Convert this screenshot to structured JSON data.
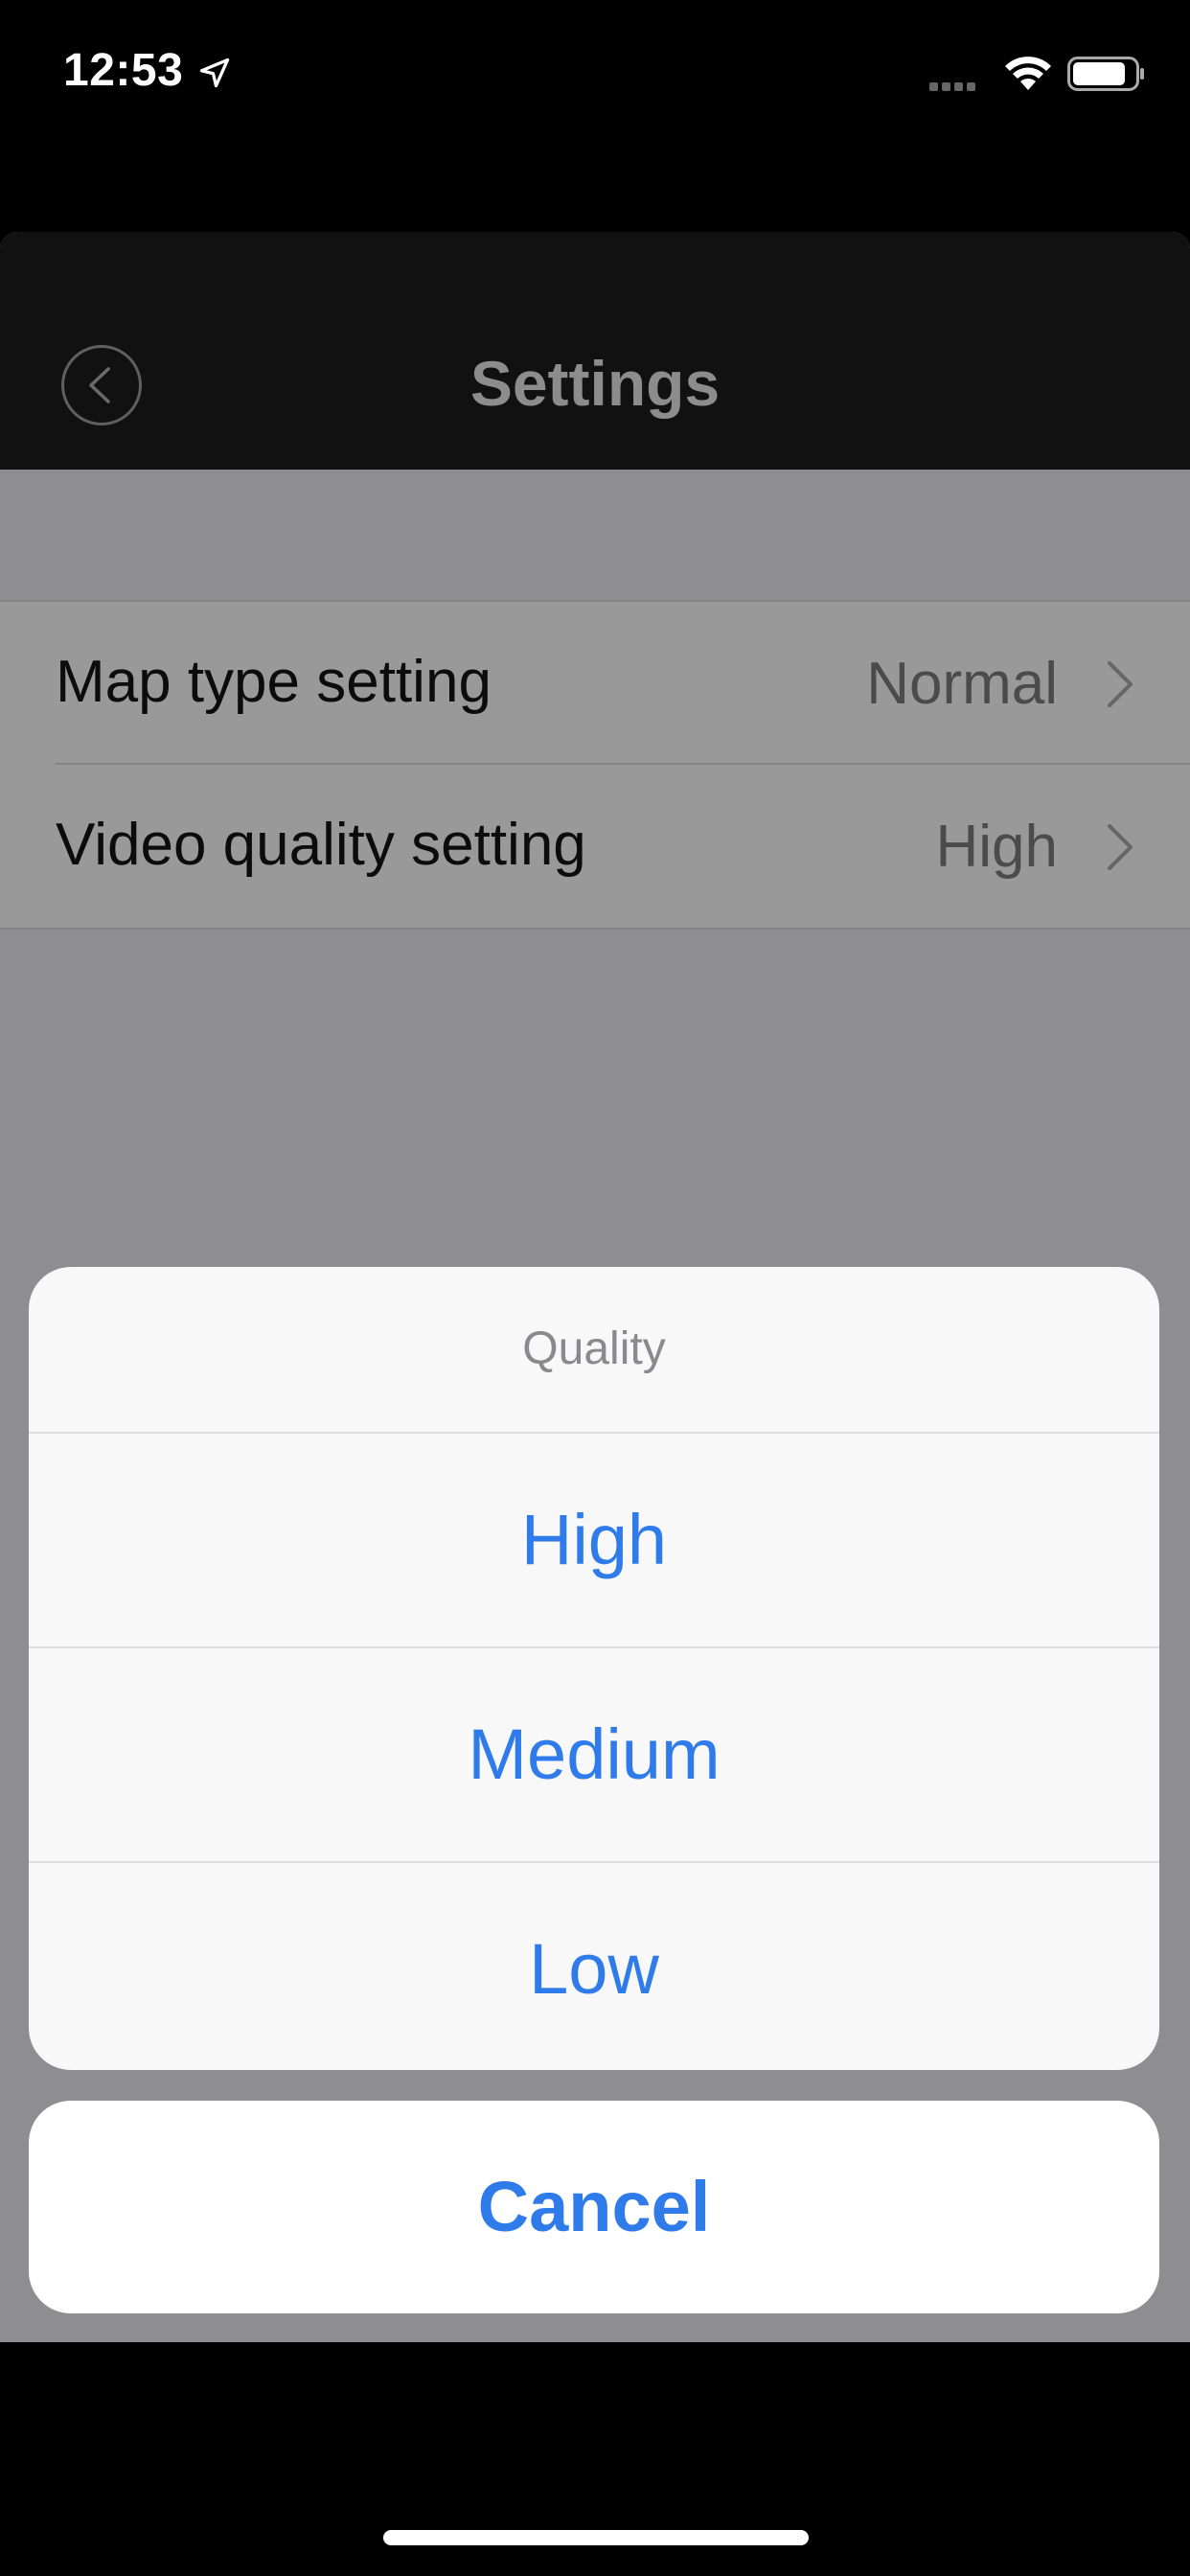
{
  "status_bar": {
    "time": "12:53",
    "icons": [
      "location-arrow-icon",
      "cellular-signal-icon",
      "wifi-icon",
      "battery-icon"
    ]
  },
  "nav": {
    "title": "Settings",
    "back_icon": "chevron-left-circle-icon"
  },
  "settings": {
    "rows": [
      {
        "label": "Map type setting",
        "value": "Normal"
      },
      {
        "label": "Video quality setting",
        "value": "High"
      }
    ]
  },
  "action_sheet": {
    "title": "Quality",
    "options": [
      "High",
      "Medium",
      "Low"
    ],
    "cancel_label": "Cancel"
  },
  "colors": {
    "accent": "#2f7bea",
    "overlay": "#8e8e90",
    "nav_background": "#111111"
  }
}
